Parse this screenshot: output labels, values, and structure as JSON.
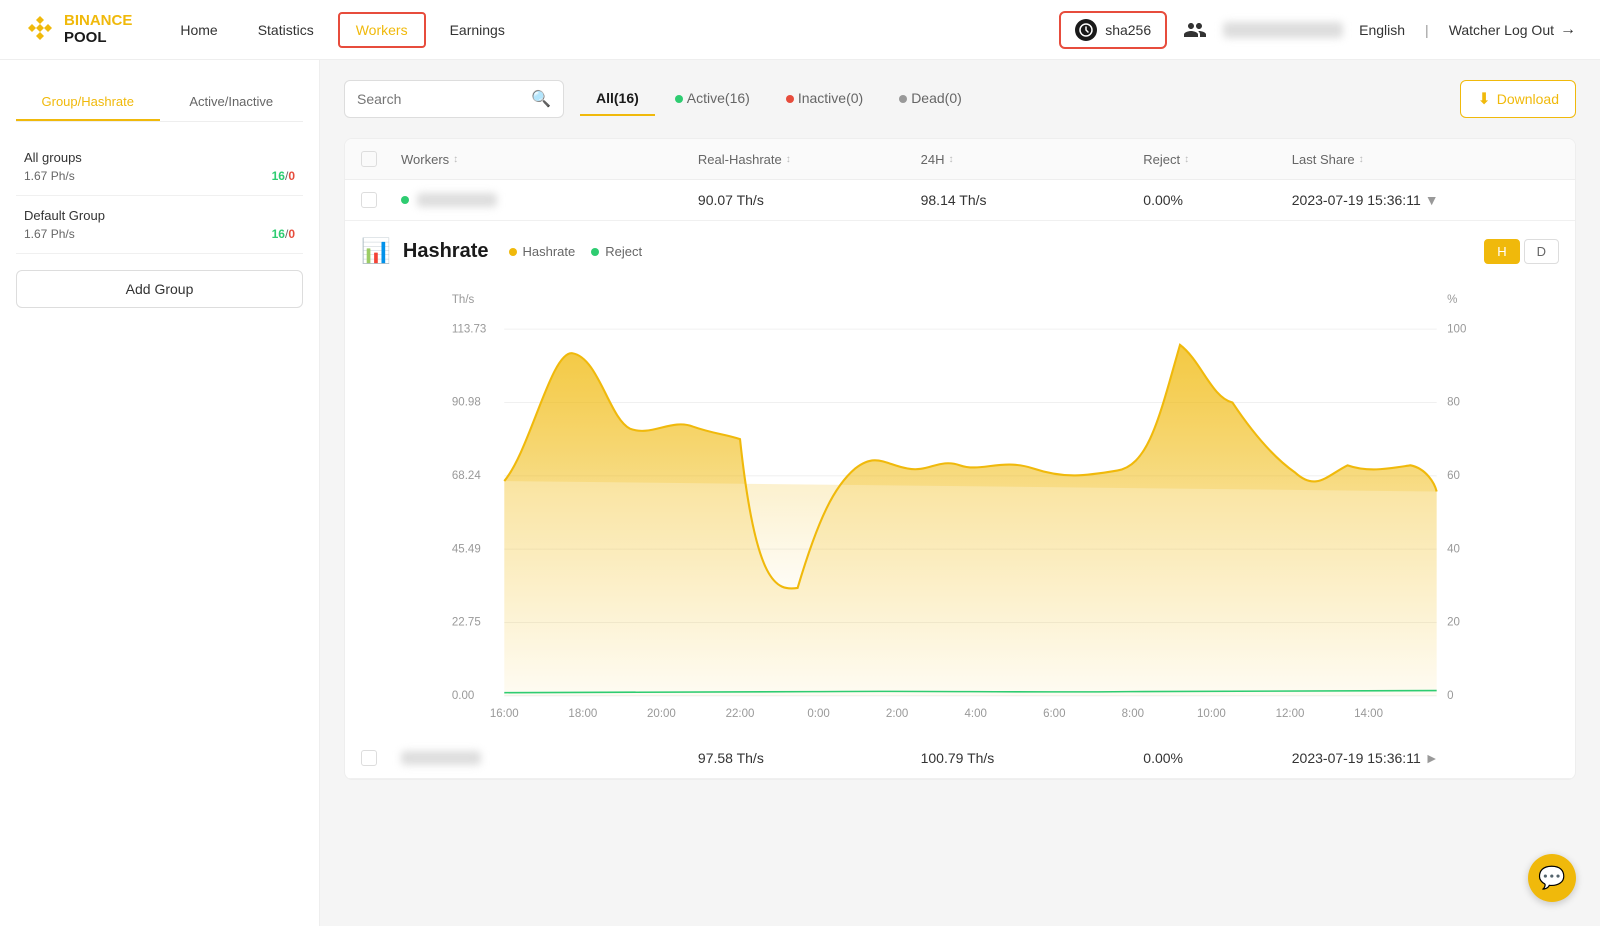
{
  "logo": {
    "line1": "BINANCE",
    "line2": "POOL"
  },
  "nav": {
    "items": [
      {
        "id": "home",
        "label": "Home",
        "active": false
      },
      {
        "id": "statistics",
        "label": "Statistics",
        "active": false
      },
      {
        "id": "workers",
        "label": "Workers",
        "active": true
      },
      {
        "id": "earnings",
        "label": "Earnings",
        "active": false
      }
    ]
  },
  "header": {
    "algo": "sha256",
    "lang": "English",
    "watcher_logout": "Watcher Log Out"
  },
  "sidebar": {
    "tab1": "Group/Hashrate",
    "tab2": "Active/Inactive",
    "groups": [
      {
        "name": "All groups",
        "hashrate": "1.67 Ph/s",
        "active": "16",
        "inactive": "0"
      },
      {
        "name": "Default Group",
        "hashrate": "1.67 Ph/s",
        "active": "16",
        "inactive": "0"
      }
    ],
    "add_group": "Add Group"
  },
  "filter_bar": {
    "search_placeholder": "Search",
    "tabs": [
      {
        "id": "all",
        "label": "All(16)",
        "active": true,
        "dot": null
      },
      {
        "id": "active",
        "label": "Active(16)",
        "active": false,
        "dot": "active"
      },
      {
        "id": "inactive",
        "label": "Inactive(0)",
        "active": false,
        "dot": "inactive"
      },
      {
        "id": "dead",
        "label": "Dead(0)",
        "active": false,
        "dot": "dead"
      }
    ],
    "download": "Download"
  },
  "table": {
    "headers": [
      {
        "id": "workers",
        "label": "Workers"
      },
      {
        "id": "real-hashrate",
        "label": "Real-Hashrate"
      },
      {
        "id": "24h",
        "label": "24H"
      },
      {
        "id": "reject",
        "label": "Reject"
      },
      {
        "id": "last-share",
        "label": "Last Share"
      }
    ],
    "rows": [
      {
        "id": "row1",
        "name_blur": true,
        "online": true,
        "real_hashrate": "90.07 Th/s",
        "h24": "98.14 Th/s",
        "reject": "0.00%",
        "last_share": "2023-07-19 15:36:11",
        "has_dropdown": true
      },
      {
        "id": "row2",
        "name_blur": true,
        "online": false,
        "real_hashrate": "97.58 Th/s",
        "h24": "100.79 Th/s",
        "reject": "0.00%",
        "last_share": "2023-07-19 15:36:11",
        "has_dropdown": true
      }
    ]
  },
  "chart": {
    "title": "Hashrate",
    "legend_hashrate": "Hashrate",
    "legend_reject": "Reject",
    "period_h": "H",
    "period_d": "D",
    "y_labels_left": [
      "113.73",
      "90.98",
      "68.24",
      "45.49",
      "22.75",
      "0.00"
    ],
    "y_labels_right": [
      "100",
      "80",
      "60",
      "40",
      "20",
      "0"
    ],
    "y_axis_left": "Th/s",
    "y_axis_right": "%",
    "x_labels": [
      "16:00",
      "18:00",
      "20:00",
      "22:00",
      "0:00",
      "2:00",
      "4:00",
      "6:00",
      "8:00",
      "10:00",
      "12:00",
      "14:00"
    ]
  },
  "colors": {
    "yellow": "#F0B90B",
    "green": "#2ecc71",
    "red": "#e74c3c",
    "border_red": "#e74c3c"
  }
}
